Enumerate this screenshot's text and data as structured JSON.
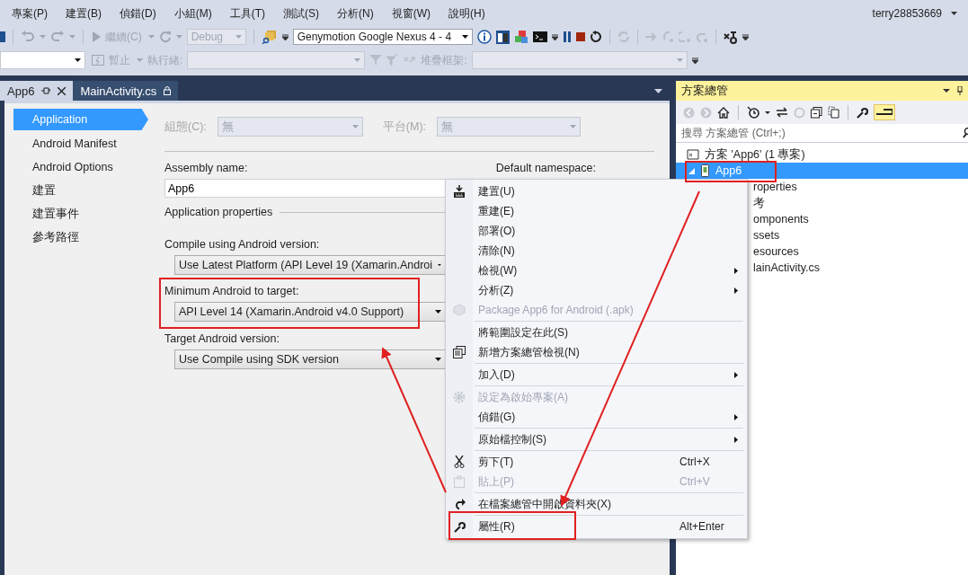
{
  "menu_bar": {
    "items": [
      "專案(P)",
      "建置(B)",
      "偵錯(D)",
      "小組(M)",
      "工具(T)",
      "測試(S)",
      "分析(N)",
      "視窗(W)",
      "說明(H)"
    ],
    "account": "terry28853669"
  },
  "toolbar": {
    "continue_label": "繼續(C)",
    "configuration": "Debug",
    "device": "Genymotion Google Nexus 4 - 4"
  },
  "debug_toolbar": {
    "suspend_label": "暫止",
    "thread_label": "執行緒:",
    "stack_label": "堆疊框架:"
  },
  "document_tabs": [
    {
      "label": "App6",
      "selected": true,
      "pinned": true
    },
    {
      "label": "MainActivity.cs",
      "selected": false,
      "pinned": false
    }
  ],
  "properties": {
    "nav": [
      {
        "label": "Application",
        "selected": true
      },
      {
        "label": "Android Manifest",
        "selected": false
      },
      {
        "label": "Android Options",
        "selected": false
      },
      {
        "label": "建置",
        "selected": false
      },
      {
        "label": "建置事件",
        "selected": false
      },
      {
        "label": "參考路徑",
        "selected": false
      }
    ],
    "configuration_label": "組態(C):",
    "configuration_value": "無",
    "platform_label": "平台(M):",
    "platform_value": "無",
    "assembly_name_label": "Assembly name:",
    "assembly_name": "App6",
    "default_namespace_label": "Default namespace:",
    "section_title": "Application properties",
    "compile_label": "Compile using Android version:",
    "compile_value": "Use Latest Platform (API Level 19 (Xamarin.Androi",
    "minimum_label": "Minimum Android to target:",
    "minimum_value": "API Level 14 (Xamarin.Android v4.0 Support)",
    "target_label": "Target Android version:",
    "target_value": "Use Compile using SDK version"
  },
  "solution_explorer": {
    "title": "方案總管",
    "search_placeholder": "搜尋 方案總管 (Ctrl+;)",
    "tree": [
      {
        "label": "方案 'App6' (1 專案)",
        "selected": false,
        "children": [
          {
            "label": "App6",
            "selected": true,
            "expanded": true,
            "children": [
              {
                "label": "roperties",
                "selected": false
              },
              {
                "label": "考",
                "selected": false
              },
              {
                "label": "omponents",
                "selected": false
              },
              {
                "label": "ssets",
                "selected": false
              },
              {
                "label": "esources",
                "selected": false
              },
              {
                "label": "lainActivity.cs",
                "selected": false
              }
            ]
          }
        ]
      }
    ]
  },
  "context_menu": [
    {
      "kind": "item",
      "label": "建置(U)",
      "disabled": false,
      "submenu": false
    },
    {
      "kind": "item",
      "label": "重建(E)",
      "disabled": false,
      "submenu": false
    },
    {
      "kind": "item",
      "label": "部署(O)",
      "disabled": false,
      "submenu": false
    },
    {
      "kind": "item",
      "label": "清除(N)",
      "disabled": false,
      "submenu": false
    },
    {
      "kind": "item",
      "label": "檢視(W)",
      "disabled": false,
      "submenu": true
    },
    {
      "kind": "item",
      "label": "分析(Z)",
      "disabled": false,
      "submenu": true
    },
    {
      "kind": "item",
      "label": "Package App6 for Android (.apk)",
      "disabled": true,
      "submenu": false
    },
    {
      "kind": "separator"
    },
    {
      "kind": "item",
      "label": "將範圍設定在此(S)",
      "disabled": false,
      "submenu": false
    },
    {
      "kind": "item",
      "label": "新增方案總管檢視(N)",
      "disabled": false,
      "submenu": false
    },
    {
      "kind": "separator"
    },
    {
      "kind": "item",
      "label": "加入(D)",
      "disabled": false,
      "submenu": true
    },
    {
      "kind": "separator"
    },
    {
      "kind": "item",
      "label": "設定為啟始專案(A)",
      "disabled": true,
      "submenu": false
    },
    {
      "kind": "item",
      "label": "偵錯(G)",
      "disabled": false,
      "submenu": true
    },
    {
      "kind": "separator"
    },
    {
      "kind": "item",
      "label": "原始檔控制(S)",
      "disabled": false,
      "submenu": true
    },
    {
      "kind": "separator"
    },
    {
      "kind": "item",
      "label": "剪下(T)",
      "disabled": false,
      "submenu": false,
      "shortcut": "Ctrl+X"
    },
    {
      "kind": "item",
      "label": "貼上(P)",
      "disabled": true,
      "submenu": false,
      "shortcut": "Ctrl+V"
    },
    {
      "kind": "separator"
    },
    {
      "kind": "item",
      "label": "在檔案總管中開啟資料夾(X)",
      "disabled": false,
      "submenu": false
    },
    {
      "kind": "separator"
    },
    {
      "kind": "item",
      "label": "屬性(R)",
      "disabled": false,
      "submenu": false,
      "shortcut": "Alt+Enter"
    }
  ]
}
